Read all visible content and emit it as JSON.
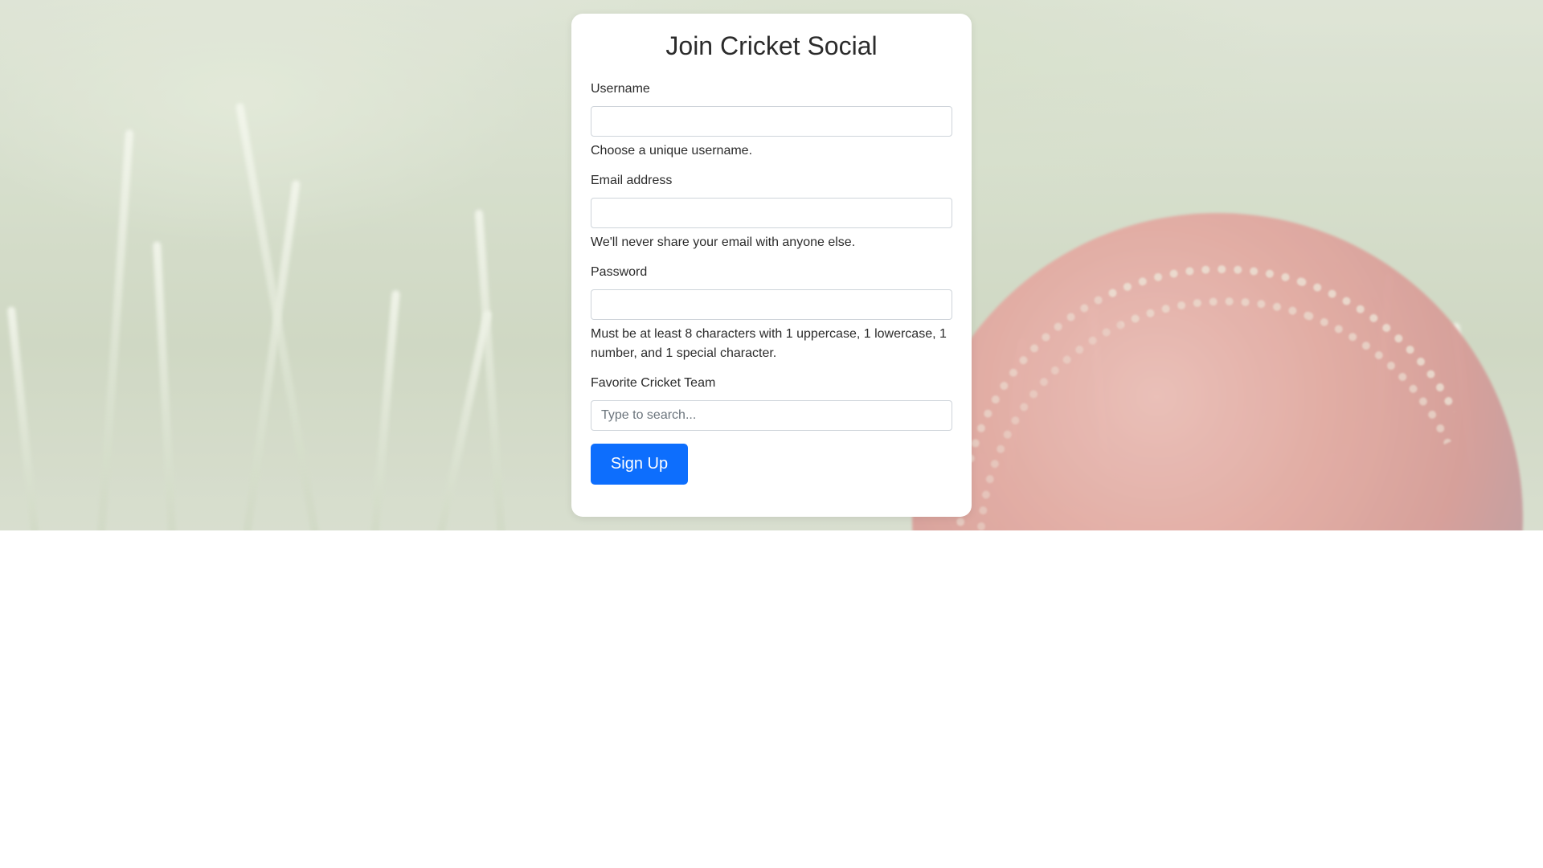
{
  "signup": {
    "title": "Join Cricket Social",
    "fields": [
      {
        "label": "Username",
        "value": "",
        "placeholder": "",
        "help": "Choose a unique username."
      },
      {
        "label": "Email address",
        "value": "",
        "placeholder": "",
        "help": "We'll never share your email with anyone else."
      },
      {
        "label": "Password",
        "value": "",
        "placeholder": "",
        "help": "Must be at least 8 characters with 1 uppercase, 1 lowercase, 1 number, and 1 special character."
      },
      {
        "label": "Favorite Cricket Team",
        "value": "",
        "placeholder": "Type to search..."
      }
    ],
    "submit_label": "Sign Up"
  },
  "colors": {
    "primary_button": "#0d6efd",
    "card_background": "#ffffff",
    "text": "#2b2b2b"
  },
  "background": {
    "description_icon": "cricket-ball-on-grass-image"
  }
}
